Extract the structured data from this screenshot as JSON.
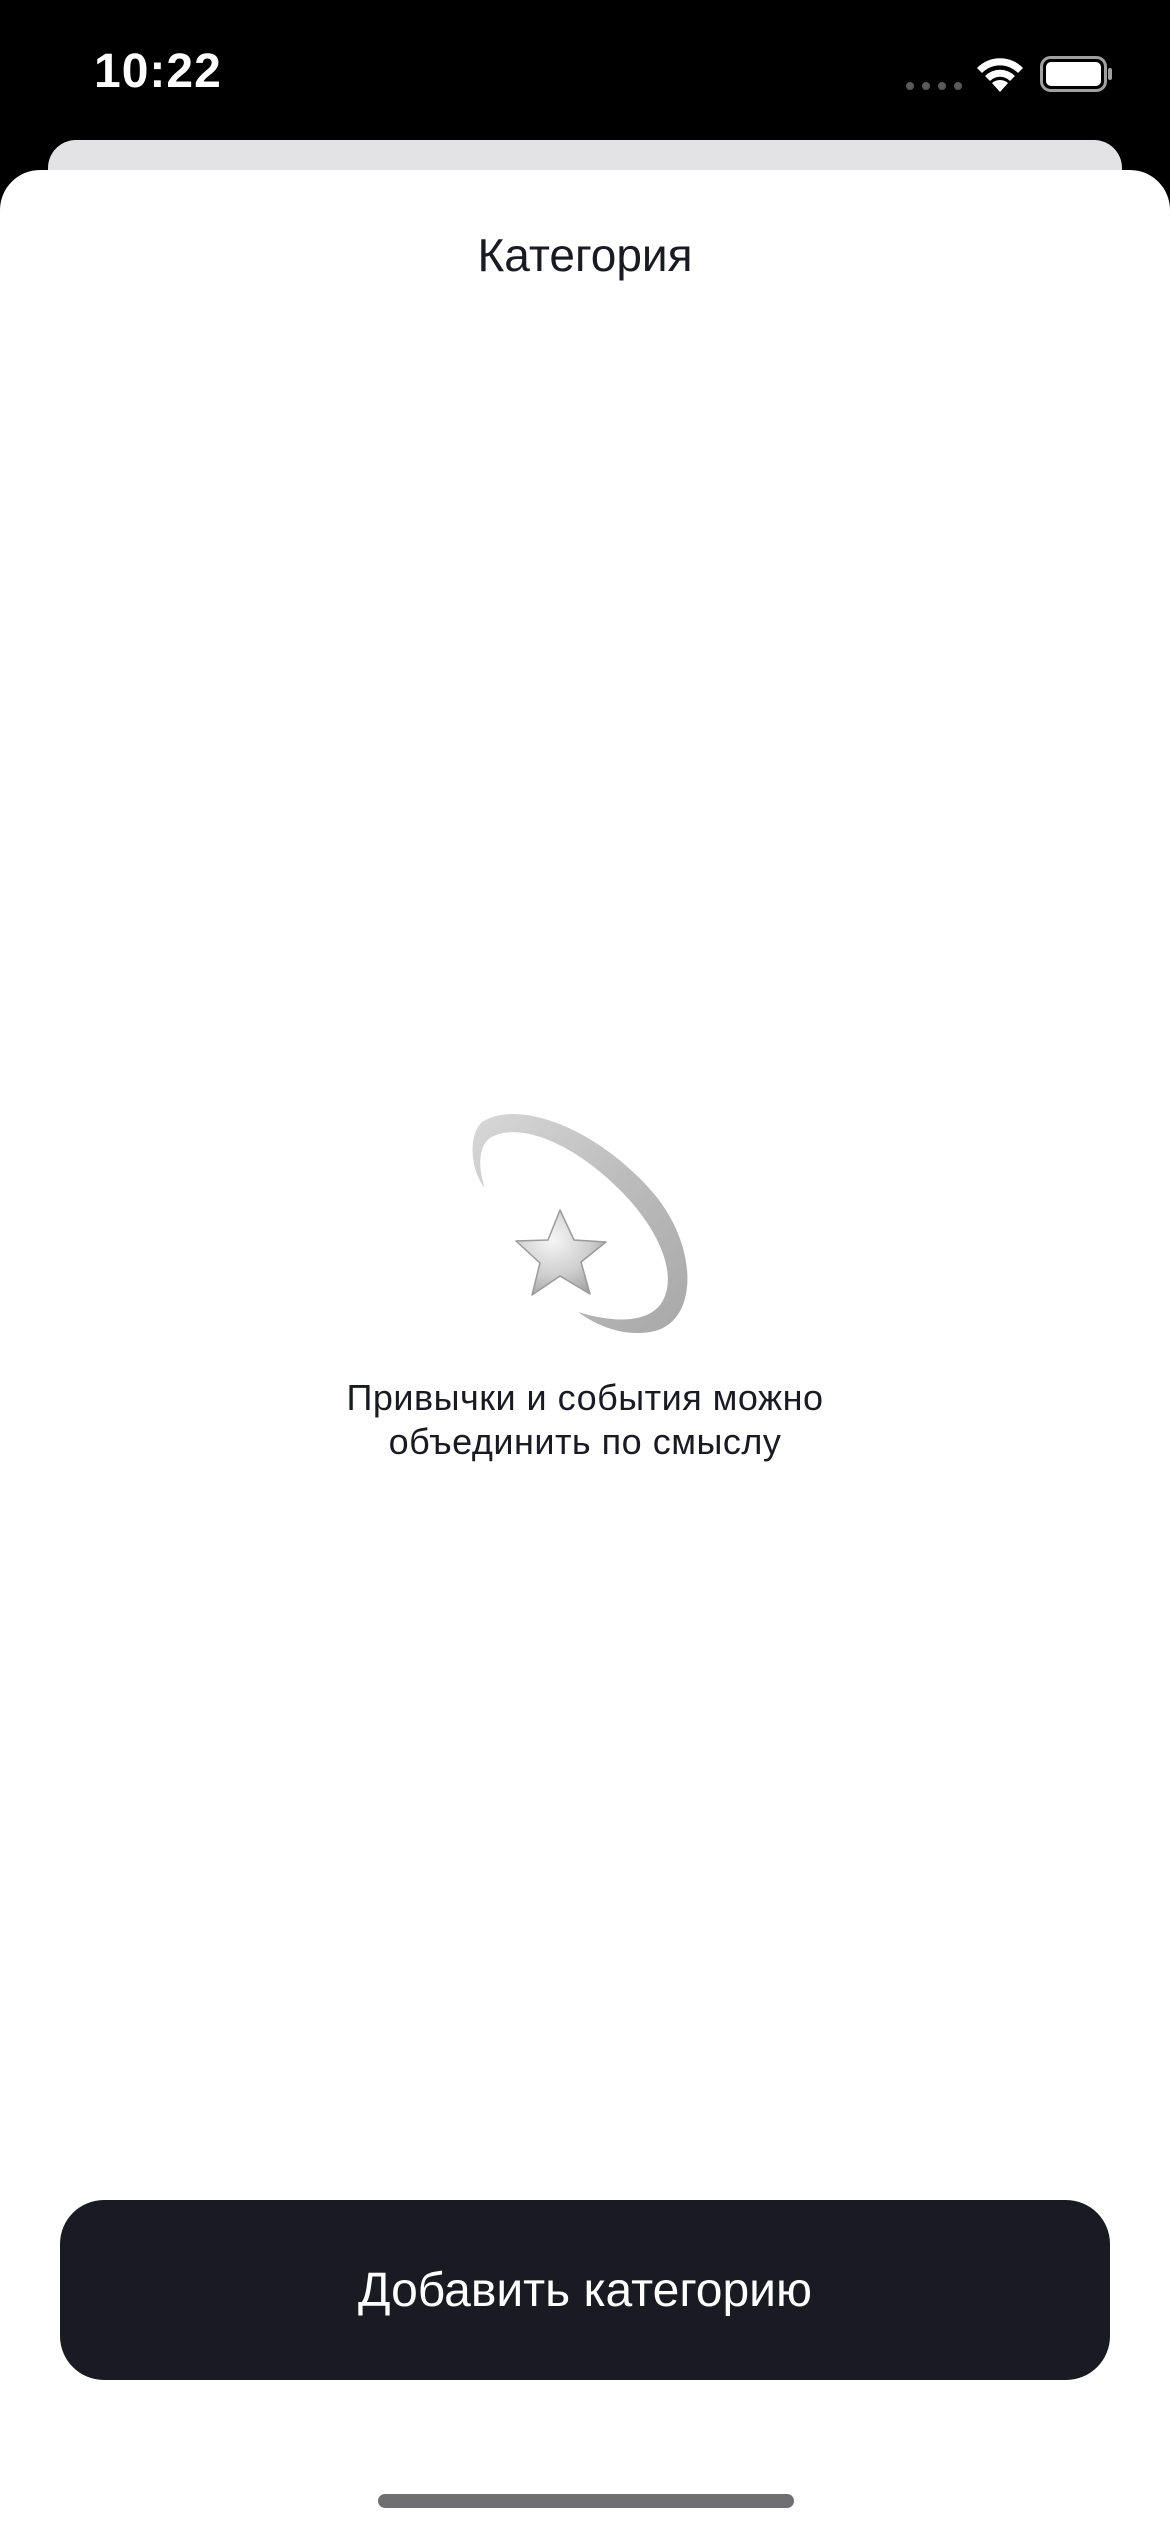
{
  "status_bar": {
    "time": "10:22",
    "signal_icon": "signal-dots-icon",
    "wifi_icon": "wifi-icon",
    "battery_icon": "battery-icon"
  },
  "sheet": {
    "title": "Категория"
  },
  "empty_state": {
    "icon": "shooting-star-icon",
    "text": "Привычки и события можно\nобъединить по смыслу"
  },
  "actions": {
    "add_category_label": "Добавить категорию"
  },
  "colors": {
    "primary": "#1A1B22",
    "background": "#FFFFFF"
  }
}
